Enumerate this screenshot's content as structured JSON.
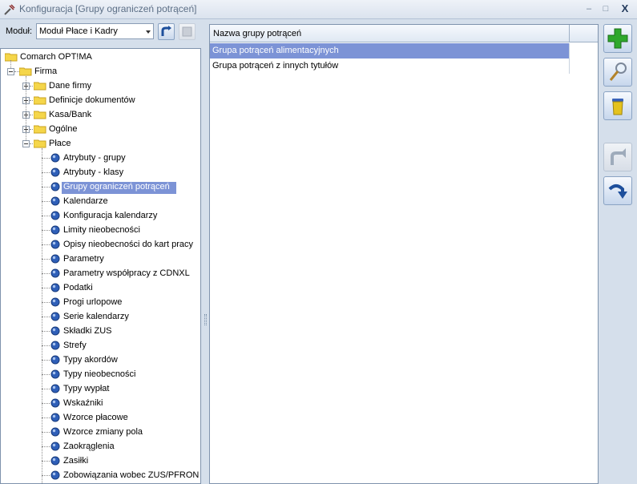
{
  "window": {
    "title": "Konfiguracja [Grupy ograniczeń potrąceń]",
    "minimize_label": "–",
    "maximize_label": "□",
    "close_label": "X"
  },
  "module": {
    "label": "Moduł:",
    "selected": "Moduł Płace i Kadry"
  },
  "tree": {
    "root": "Comarch OPT!MA",
    "firma": "Firma",
    "folders": [
      "Dane firmy",
      "Definicje dokumentów",
      "Kasa/Bank",
      "Ogólne",
      "Płace"
    ],
    "place_items": [
      "Atrybuty - grupy",
      "Atrybuty - klasy",
      "Grupy ograniczeń potrąceń",
      "Kalendarze",
      "Konfiguracja kalendarzy",
      "Limity nieobecności",
      "Opisy nieobecności do kart pracy",
      "Parametry",
      "Parametry współpracy z CDNXL",
      "Podatki",
      "Progi urlopowe",
      "Serie kalendarzy",
      "Składki ZUS",
      "Strefy",
      "Typy akordów",
      "Typy nieobecności",
      "Typy wypłat",
      "Wskaźniki",
      "Wzorce płacowe",
      "Wzorce zmiany pola",
      "Zaokrąglenia",
      "Zasiłki",
      "Zobowiązania wobec ZUS/PFRON"
    ],
    "selected_item": "Grupy ograniczeń potrąceń"
  },
  "grid": {
    "column_header": "Nazwa grupy potrąceń",
    "rows": [
      "Grupa potrąceń alimentacyjnych",
      "Grupa potrąceń z innych tytułów"
    ],
    "selected_row": 0
  },
  "actions": {
    "icons": [
      "plus-icon",
      "magnifier-icon",
      "trash-icon",
      "undo-icon",
      "redo-icon"
    ]
  },
  "colors": {
    "selection": "#7c93d6",
    "window_bg": "#d5dfeb",
    "folder": "#f5d64a",
    "add_green": "#2fa82c"
  }
}
